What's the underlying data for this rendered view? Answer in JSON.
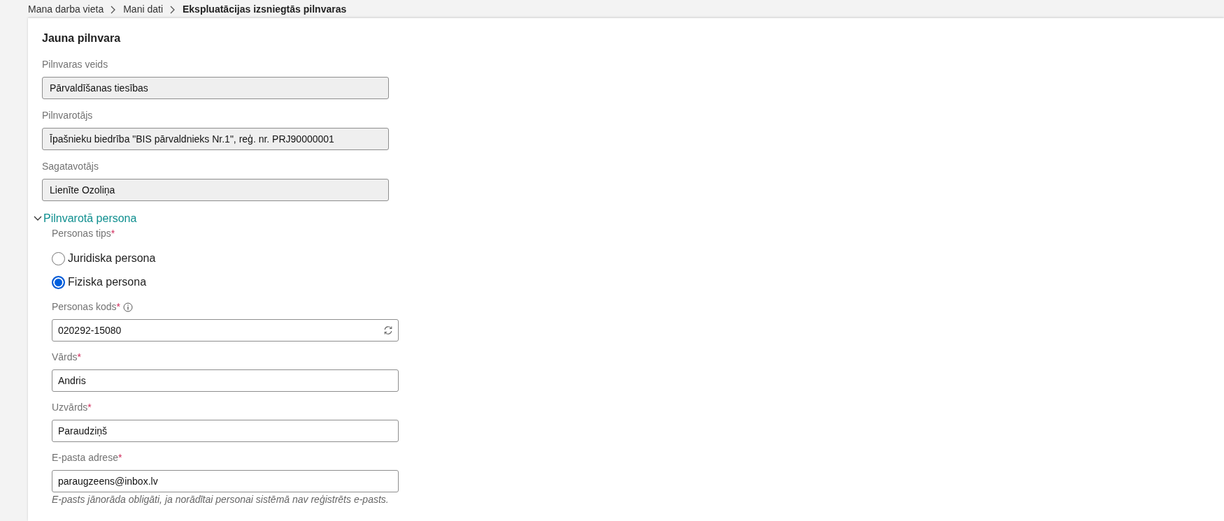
{
  "breadcrumb": [
    {
      "label": "Mana darba vieta",
      "current": false
    },
    {
      "label": "Mani dati",
      "current": false
    },
    {
      "label": "Ekspluatācijas izsniegtās pilnvaras",
      "current": true
    }
  ],
  "form": {
    "title": "Jauna pilnvara",
    "readonly_fields": [
      {
        "label": "Pilnvaras veids",
        "value": "Pārvaldīšanas tiesības"
      },
      {
        "label": "Pilnvarotājs",
        "value": "Īpašnieku biedrība \"BIS pārvaldnieks Nr.1\", reģ. nr. PRJ90000001"
      },
      {
        "label": "Sagatavotājs",
        "value": "Lienīte Ozoliņa"
      }
    ],
    "section": {
      "title": "Pilnvarotā persona",
      "expanded": true,
      "person_type": {
        "label": "Personas tips",
        "required_mark": "*",
        "options": [
          {
            "label": "Juridiska persona",
            "selected": false
          },
          {
            "label": "Fiziska persona",
            "selected": true
          }
        ]
      },
      "fields": [
        {
          "label": "Personas kods",
          "required_mark": "*",
          "info": true,
          "kind": "refresh",
          "value": "020292-15080"
        },
        {
          "label": "Vārds",
          "required_mark": "*",
          "info": false,
          "kind": "text",
          "value": "Andris"
        },
        {
          "label": "Uzvārds",
          "required_mark": "*",
          "info": false,
          "kind": "text",
          "value": "Paraudziņš"
        },
        {
          "label": "E-pasta adrese",
          "required_mark": "*",
          "info": false,
          "kind": "text",
          "value": "paraugzeens@inbox.lv",
          "help": "E-pasts jānorāda obligāti, ja norādītai personai sistēmā nav reģistrēts e-pasts."
        }
      ]
    }
  }
}
